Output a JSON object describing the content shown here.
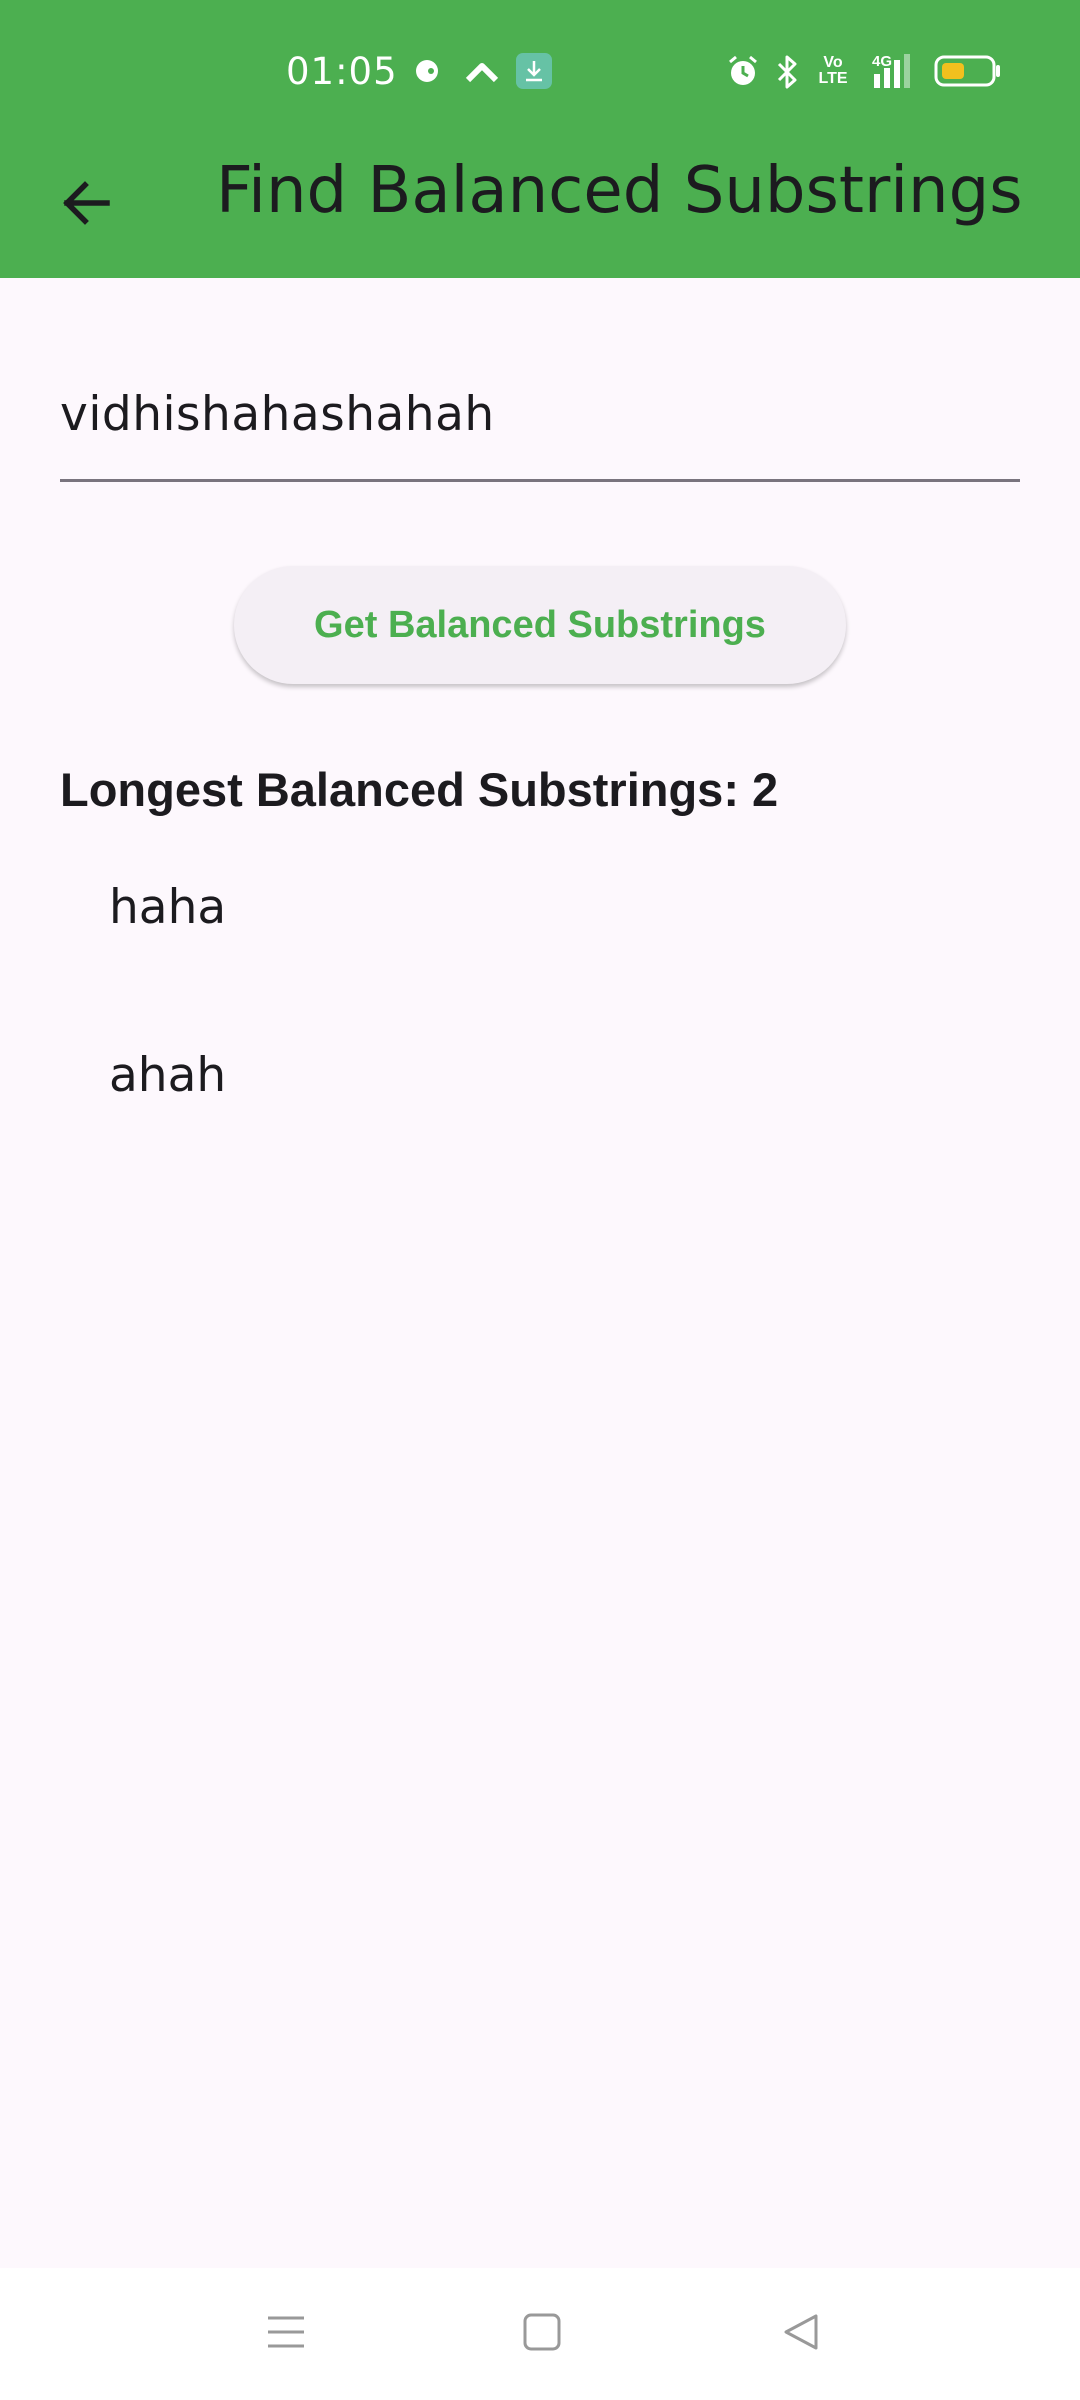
{
  "status_bar": {
    "time": "01:05",
    "icons": [
      "chat-bubble-icon",
      "arrow-up-icon",
      "download-icon",
      "alarm-icon",
      "bluetooth-icon",
      "volte-icon",
      "4g-signal-icon",
      "battery-icon"
    ],
    "network_label": "4G",
    "volte_label": "Vo LTE"
  },
  "app_bar": {
    "title": "Find Balanced Substrings",
    "back_icon": "arrow-back-icon"
  },
  "input": {
    "value": "vidhishahashahah"
  },
  "button": {
    "label": "Get Balanced Substrings"
  },
  "result": {
    "title": "Longest Balanced Substrings: 2",
    "items": [
      "haha",
      "ahah"
    ]
  },
  "nav_bar": {
    "icons": [
      "menu-icon",
      "home-icon",
      "back-triangle-icon"
    ]
  },
  "colors": {
    "primary": "#4caf50",
    "background": "#fdf8fd",
    "button_bg": "#f4eff5",
    "text": "#1c1b1f"
  }
}
